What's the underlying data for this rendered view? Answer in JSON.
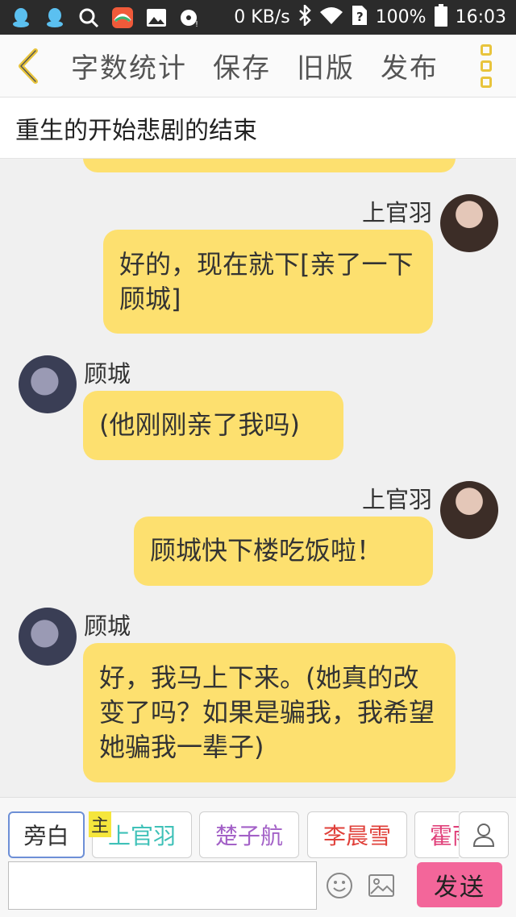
{
  "status_bar": {
    "net_speed": "0 KB/s",
    "battery": "100%",
    "time": "16:03",
    "icons": [
      "qq-icon",
      "qq-icon",
      "search-icon",
      "app-icon",
      "image-icon",
      "disc-icon",
      "bluetooth-icon",
      "wifi-icon",
      "no-sim-icon",
      "battery-icon"
    ]
  },
  "toolbar": {
    "back_icon": "chevron-left-icon",
    "items": [
      "字数统计",
      "保存",
      "旧版",
      "发布"
    ],
    "menu_icon": "more-vertical-icon",
    "accent": "#e8c43c"
  },
  "story": {
    "title": "重生的开始悲剧的结束"
  },
  "messages": [
    {
      "speaker": "上官羽",
      "side": "right",
      "text": "好的，现在就下[亲了一下顾城]"
    },
    {
      "speaker": "顾城",
      "side": "left",
      "text": "(他刚刚亲了我吗)"
    },
    {
      "speaker": "上官羽",
      "side": "right",
      "text": "顾城快下楼吃饭啦！"
    },
    {
      "speaker": "顾城",
      "side": "left",
      "text": "好，我马上下来。(她真的改变了吗？如果是骗我，我希望她骗我一辈子)"
    }
  ],
  "characters": {
    "host_tag": "主",
    "chips": [
      {
        "label": "旁白",
        "color": "#555555"
      },
      {
        "label": "上官羽",
        "color": "#3fc1b8"
      },
      {
        "label": "楚子航",
        "color": "#a361c7"
      },
      {
        "label": "李晨雪",
        "color": "#e0403a"
      },
      {
        "label": "霍雨",
        "color": "#e0407a"
      }
    ],
    "person_icon": "person-icon"
  },
  "composer": {
    "placeholder": "",
    "emoji_icon": "emoji-icon",
    "image_icon": "image-icon",
    "send_label": "发送",
    "send_color": "#f3669a"
  },
  "bubble_color": "#fde06f"
}
